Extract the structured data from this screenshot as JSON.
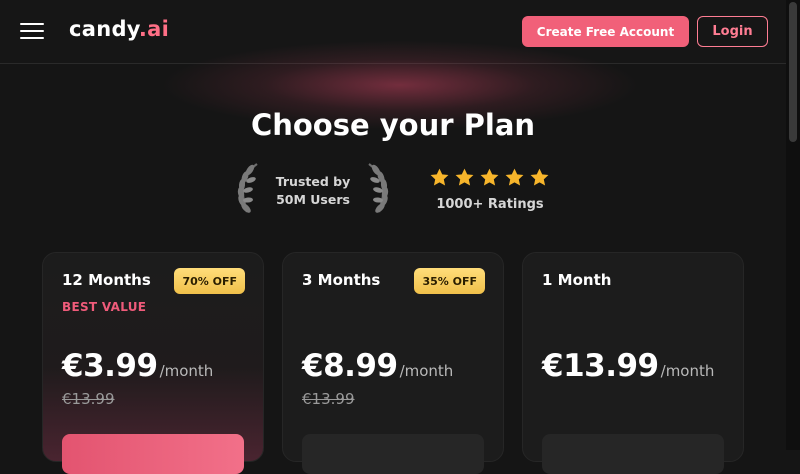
{
  "header": {
    "logo_main": "candy",
    "logo_accent": ".ai",
    "create_account_label": "Create Free Account",
    "login_label": "Login"
  },
  "hero": {
    "title": "Choose your Plan",
    "trust_line1": "Trusted by",
    "trust_line2": "50M Users",
    "star_count": 5,
    "ratings_text": "1000+ Ratings"
  },
  "plans": [
    {
      "name": "12 Months",
      "badge": "70% OFF",
      "tag": "BEST VALUE",
      "price": "€3.99",
      "per": "/month",
      "old_price": "€13.99"
    },
    {
      "name": "3 Months",
      "badge": "35% OFF",
      "price": "€8.99",
      "per": "/month",
      "old_price": "€13.99"
    },
    {
      "name": "1 Month",
      "price": "€13.99",
      "per": "/month"
    }
  ],
  "colors": {
    "accent": "#f16079",
    "badge_gold": "#f5c84f",
    "background": "#151515",
    "best_value": "#ef5b7a"
  },
  "icons": {
    "menu": "hamburger-menu-icon",
    "laurel": "laurel-wreath-icon",
    "star": "star-icon"
  }
}
